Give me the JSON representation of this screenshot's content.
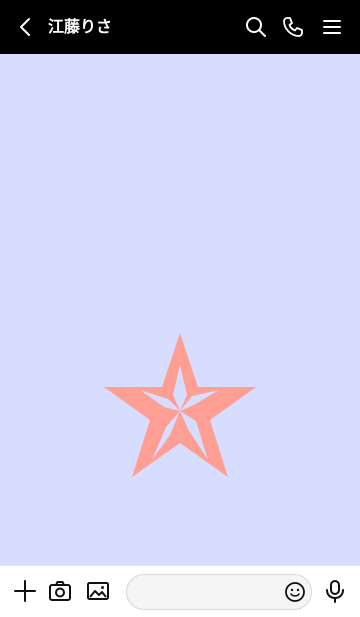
{
  "header": {
    "title": "江藤りさ",
    "background": "#000000",
    "icons": [
      "back-chevron-icon",
      "search-icon",
      "phone-icon",
      "menu-icon"
    ]
  },
  "chat": {
    "background": "#d6ddff",
    "decoration": "star",
    "star_color": "#ff9f94"
  },
  "footer": {
    "icons": [
      "plus-icon",
      "camera-icon",
      "image-icon",
      "emoji-icon",
      "microphone-icon"
    ],
    "message_placeholder": ""
  }
}
